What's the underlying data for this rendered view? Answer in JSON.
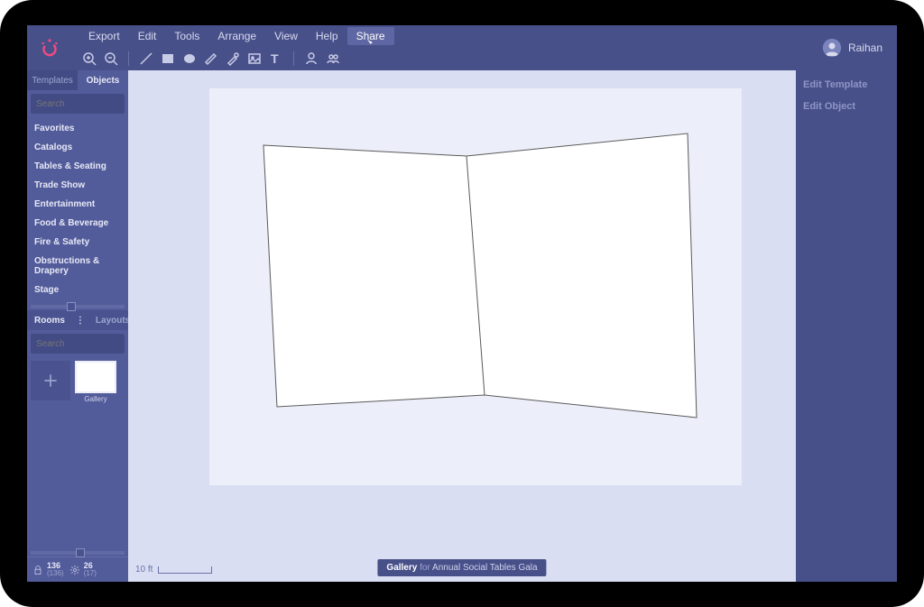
{
  "menu": {
    "export": "Export",
    "edit": "Edit",
    "tools": "Tools",
    "arrange": "Arrange",
    "view": "View",
    "help": "Help",
    "share": "Share"
  },
  "user": {
    "name": "Raihan"
  },
  "sidebar": {
    "tabs": {
      "templates": "Templates",
      "objects": "Objects"
    },
    "search_placeholder": "Search",
    "categories": [
      "Favorites",
      "Catalogs",
      "Tables & Seating",
      "Trade Show",
      "Entertainment",
      "Food & Beverage",
      "Fire & Safety",
      "Obstructions & Drapery",
      "Stage"
    ],
    "rooms_tab": "Rooms",
    "layouts_tab": "Layouts",
    "layout_thumb_label": "Gallery",
    "status1_top": "136",
    "status1_bottom": "(136)",
    "status2_top": "26",
    "status2_bottom": "(17)"
  },
  "canvas": {
    "scale_label": "10 ft",
    "footer_room": "Gallery",
    "footer_sep": "for",
    "footer_event": "Annual Social Tables Gala"
  },
  "right": {
    "edit_template": "Edit Template",
    "edit_object": "Edit Object"
  }
}
